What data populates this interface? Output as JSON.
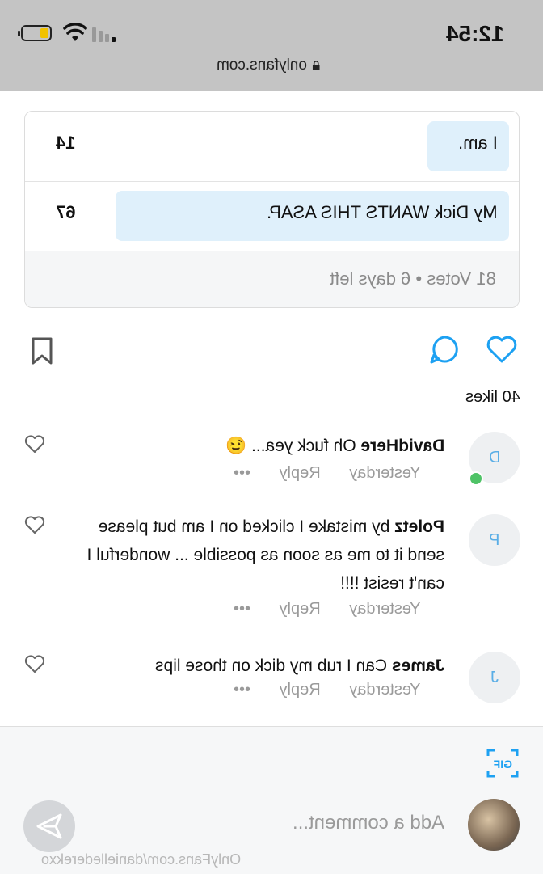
{
  "status_bar": {
    "time": "12:54",
    "url": "onlyfans.com"
  },
  "poll": {
    "options": [
      {
        "label": "I am.",
        "percent": "14",
        "fill": 0.14
      },
      {
        "label": "My Dick WANTS THIS ASAP.",
        "percent": "67",
        "fill": 0.67
      }
    ],
    "votes_text": "81 Votes • 6 days left"
  },
  "post": {
    "likes_text": "40 likes"
  },
  "comments": [
    {
      "initial": "D",
      "author": "DavidHere",
      "text": "Oh fuck yea...",
      "emoji": "😉",
      "time": "Yesterday",
      "reply": "Reply",
      "more": "•••",
      "online": true
    },
    {
      "initial": "P",
      "author": "Poletz",
      "text": "by mistake I clicked on I am but please send it to me as soon as possible ... wonderful I can't resist !!!!",
      "time": "Yesterday",
      "reply": "Reply",
      "more": "•••",
      "online": false
    },
    {
      "initial": "J",
      "author": "James",
      "text": "Can I rub my dick on those lips",
      "time": "Yesterday",
      "reply": "Reply",
      "more": "•••",
      "online": false
    }
  ],
  "composer": {
    "placeholder": "Add a comment...",
    "watermark": "OnlyFans.com/daniellederekxo"
  },
  "colors": {
    "accent": "#00aff0",
    "poll_bar": "#dff0fb",
    "status_bg": "#c4c4c4",
    "online": "#4fc367"
  }
}
